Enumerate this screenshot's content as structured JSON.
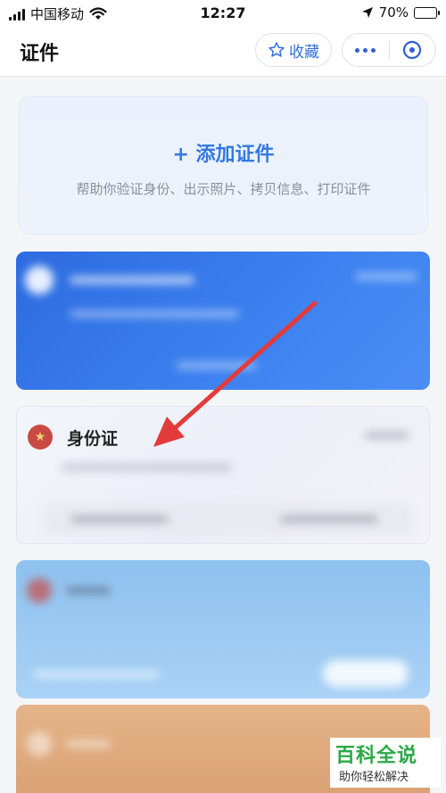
{
  "status_bar": {
    "carrier": "中国移动",
    "time": "12:27",
    "battery": "70%",
    "battery_level": 0.7
  },
  "nav": {
    "title": "证件",
    "favorite_label": "收藏"
  },
  "add_card": {
    "title": "+ 添加证件",
    "subtitle": "帮助你验证身份、出示照片、拷贝信息、打印证件"
  },
  "id_card": {
    "label": "身份证"
  },
  "watermark": {
    "title": "百科全说",
    "subtitle": "助你轻松解决"
  },
  "colors": {
    "accent": "#3478e2",
    "arrow": "#e23b3b",
    "watermark_green": "#2aa845"
  }
}
